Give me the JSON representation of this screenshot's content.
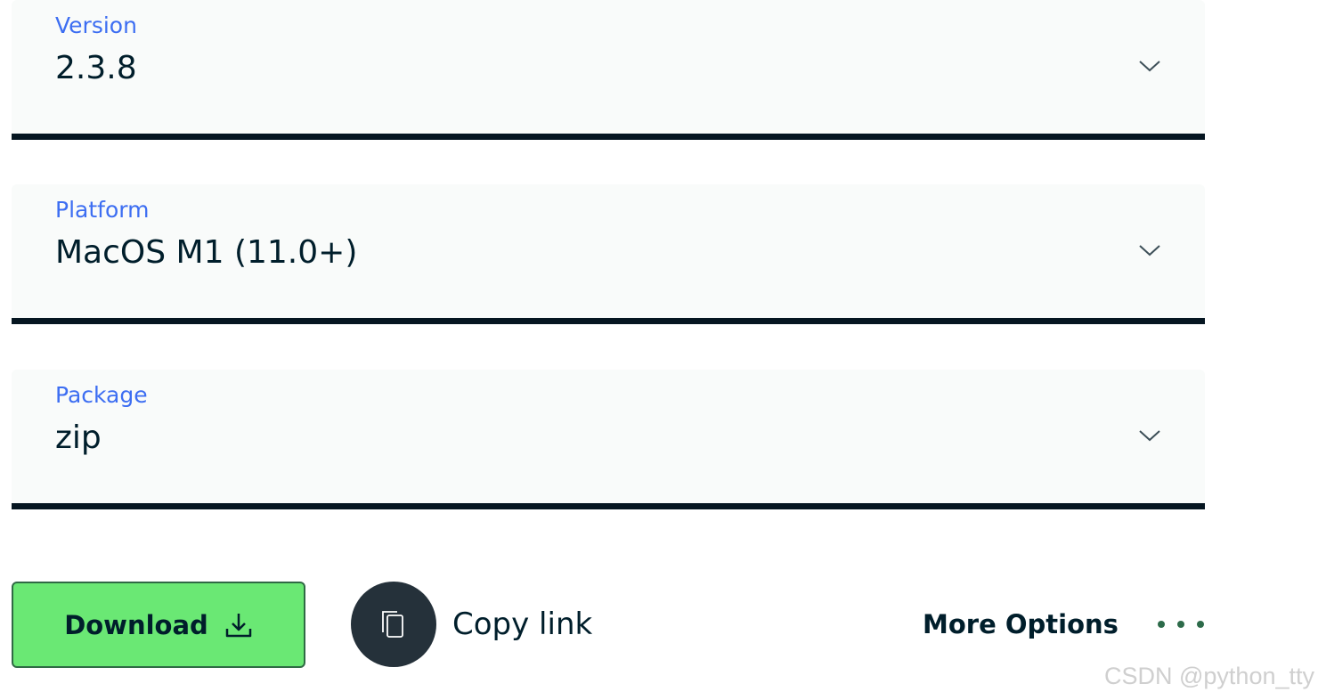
{
  "selects": [
    {
      "label": "Version",
      "value": "2.3.8"
    },
    {
      "label": "Platform",
      "value": "MacOS M1 (11.0+)"
    },
    {
      "label": "Package",
      "value": "zip"
    }
  ],
  "actions": {
    "download_label": "Download",
    "copy_link_label": "Copy link",
    "more_options_label": "More Options"
  },
  "watermark": "CSDN @python_tty",
  "colors": {
    "accent_label": "#3d6ef2",
    "download_bg": "#6ae874",
    "border_dark": "#061621"
  }
}
